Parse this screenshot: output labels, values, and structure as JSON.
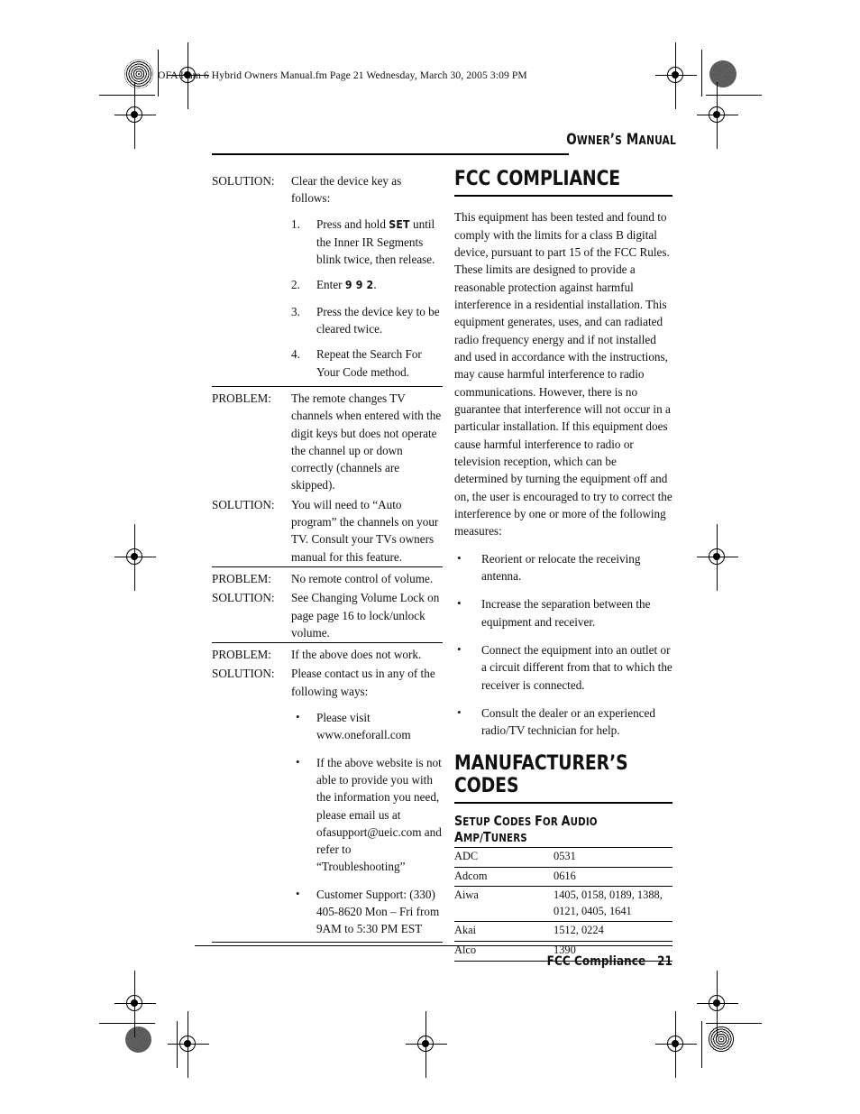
{
  "page": {
    "file_banner": "OFA Kam 6 Hybrid Owners Manual.fm  Page 21  Wednesday, March 30, 2005  3:09 PM",
    "running_head_first": "O",
    "running_head_rest_1": "WNER",
    "running_head_apos": "’S ",
    "running_head_m": "M",
    "running_head_rest_2": "ANUAL",
    "running_head_plain": "Owner’s Manual",
    "footer_title": "FCC Compliance",
    "footer_page": "21"
  },
  "left_column": {
    "groups": [
      {
        "label": "SOLUTION:",
        "text": "Clear the device key as follows:",
        "steps": [
          {
            "num": "1.",
            "pre": "Press and hold ",
            "key": "SET",
            "post": " until the Inner IR Segments blink twice, then release."
          },
          {
            "num": "2.",
            "pre": "Enter ",
            "key": "9 9 2",
            "post": "."
          },
          {
            "num": "3.",
            "pre": "Press the device key to be cleared twice.",
            "key": "",
            "post": ""
          },
          {
            "num": "4.",
            "pre": "Repeat the Search For Your Code method.",
            "key": "",
            "post": ""
          }
        ]
      },
      {
        "problem_label": "PROBLEM:",
        "problem_text": "The remote changes TV channels when entered with the digit keys but does not operate the channel up or down correctly (channels are skipped).",
        "solution_label": "SOLUTION:",
        "solution_text": "You will need to “Auto program” the channels on your TV. Consult your TVs owners manual for this feature."
      },
      {
        "problem_label": "PROBLEM:",
        "problem_text": "No remote control of volume.",
        "solution_label": "SOLUTION:",
        "solution_text": "See Changing Volume Lock on page page 16 to lock/unlock volume."
      },
      {
        "problem_label": "PROBLEM:",
        "problem_text": "If the above does not work.",
        "solution_label": "SOLUTION:",
        "solution_text": "Please contact us in any of the following ways:",
        "bullets": [
          "Please visit www.oneforall.com",
          "If the above website is not able to provide you with the information you need, please email us at ofasupport@ueic.com and refer to “Troubleshooting”",
          "Customer Support: (330) 405-8620 Mon – Fri from 9AM to 5:30 PM EST"
        ]
      }
    ]
  },
  "right_column": {
    "fcc": {
      "heading": "FCC COMPLIANCE",
      "paragraph": "This equipment has been tested and found to comply with the limits for a class B digital device, pursuant to part 15 of the FCC Rules. These limits are designed to provide a reasonable protection against harmful interference in a residential installation. This equipment generates, uses, and can radiated radio frequency energy and if not installed and used in accordance with the instructions, may cause harmful interference to radio communications. However, there is no guarantee that interference will not occur in a particular installation. If this equipment does cause harmful interference to radio or television reception, which can be determined by turning the equipment off and on, the user is encouraged to try to correct the interference by one or more of the following measures:",
      "measures": [
        "Reorient or relocate the receiving antenna.",
        "Increase the separation between the equipment and receiver.",
        "Connect the equipment into an outlet or a circuit different from that to which the receiver is connected.",
        "Consult the dealer or an experienced radio/TV technician for help."
      ]
    },
    "codes": {
      "heading": "MANUFACTURER’S CODES",
      "subheading_parts": {
        "s": "S",
        "etup": "ETUP ",
        "c": "C",
        "odes": "ODES ",
        "f": "F",
        "or": "OR ",
        "a": "A",
        "udio": "UDIO ",
        "a2": "A",
        "mp": "MP/",
        "t": "T",
        "uners": "UNERS"
      },
      "subheading_plain": "Setup Codes For Audio Amp/Tuners",
      "rows": [
        {
          "brand": "ADC",
          "codes": "0531"
        },
        {
          "brand": "Adcom",
          "codes": "0616"
        },
        {
          "brand": "Aiwa",
          "codes": "1405, 0158, 0189, 1388, 0121, 0405, 1641"
        },
        {
          "brand": "Akai",
          "codes": "1512, 0224"
        },
        {
          "brand": "Alco",
          "codes": "1390"
        }
      ]
    }
  }
}
